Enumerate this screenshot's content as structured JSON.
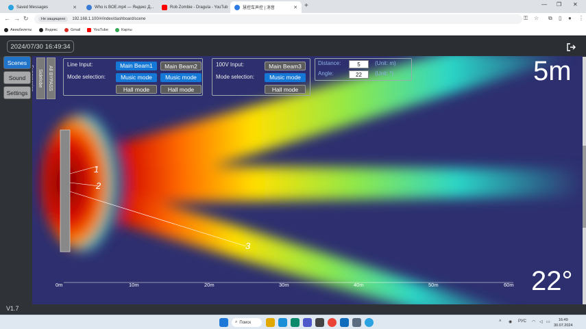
{
  "browser": {
    "tabs": [
      {
        "title": "Saved Messages",
        "color": "#2aa3e0"
      },
      {
        "title": "Who is BOE.mp4 — Яндекс Д...",
        "color": "#3a7bd5"
      },
      {
        "title": "Rob Zombie - Dragula - YouTub",
        "color": "#ff0000"
      },
      {
        "title": "慧控车声控 | 消音",
        "color": "#2c7be5"
      }
    ],
    "new_tab": "+",
    "security_label": "Не защищено",
    "url": "192.168.1.100/#/index/dashboard/scene",
    "bookmarks": [
      "Авиабилеты",
      "Яндекс",
      "Gmail",
      "YouTube",
      "Карты"
    ]
  },
  "app": {
    "datetime": "2024/07/30 16:49:34",
    "sidebar": [
      "Scenes",
      "Sound",
      "Settings"
    ],
    "sidelobe_label": "Sidelobe Suppression",
    "bypass_label": "All BYPASS",
    "line_input": {
      "label": "Line Input:",
      "mode_label": "Mode selection:",
      "beams": [
        "Main Beam1",
        "Main Beam2"
      ],
      "music": [
        "Music mode",
        "Music mode"
      ],
      "hall": [
        "Hall mode",
        "Hall mode"
      ]
    },
    "v100_input": {
      "label": "100V Input:",
      "mode_label": "Mode selection:",
      "beam": "Main Beam3",
      "music": "Music mode",
      "hall": "Hall mode"
    },
    "distance": {
      "label": "Distance:",
      "value": "5",
      "unit": "(Unit:  m)"
    },
    "angle": {
      "label": "Angle:",
      "value": "22",
      "unit": "(Unit:  °)"
    },
    "distance_big": "5m",
    "angle_big": "22°",
    "beam_numbers": [
      "1",
      "2",
      "3"
    ],
    "scale": [
      "0m",
      "10m",
      "20m",
      "30m",
      "40m",
      "50m",
      "60m"
    ],
    "version": "V1.7"
  },
  "taskbar": {
    "search": "Поиск",
    "lang": "РУС",
    "time": "16:49",
    "date": "30.07.2024"
  }
}
